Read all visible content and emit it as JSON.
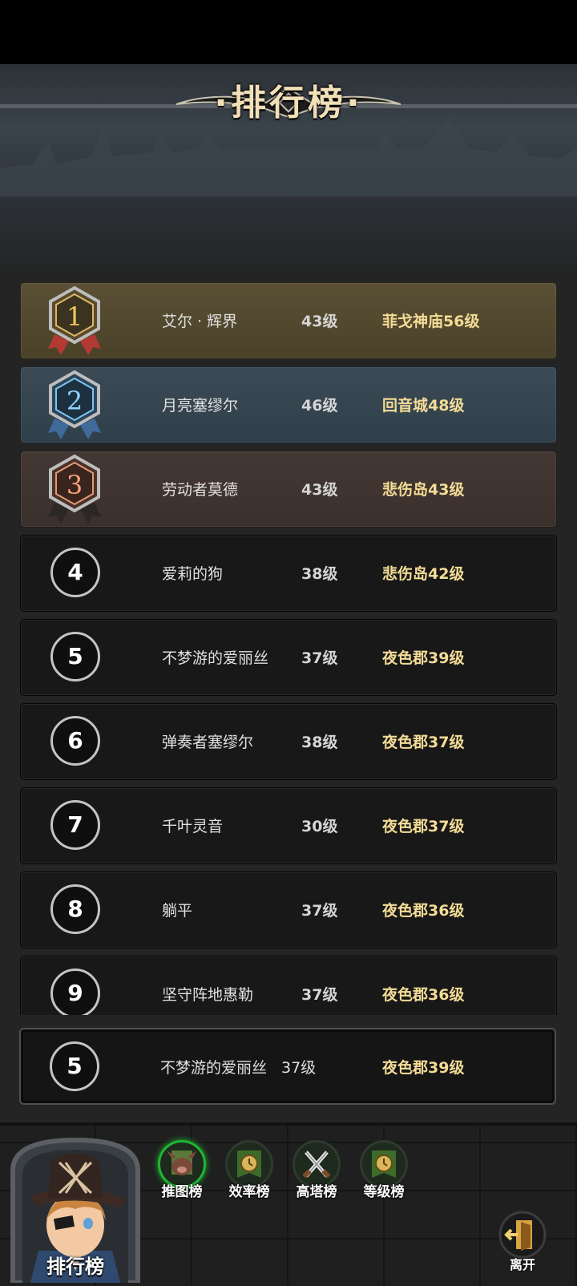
{
  "header": {
    "title": "·排行榜·"
  },
  "leaderboard": [
    {
      "rank": "1",
      "medal": "gold",
      "name": "艾尔 · 辉界",
      "level": "43级",
      "stage": "菲戈神庙56级"
    },
    {
      "rank": "2",
      "medal": "silver",
      "name": "月亮塞缪尔",
      "level": "46级",
      "stage": "回音城48级"
    },
    {
      "rank": "3",
      "medal": "bronze",
      "name": "劳动者莫德",
      "level": "43级",
      "stage": "悲伤岛43级"
    },
    {
      "rank": "4",
      "name": "爱莉的狗",
      "level": "38级",
      "stage": "悲伤岛42级"
    },
    {
      "rank": "5",
      "name": "不梦游的爱丽丝",
      "level": "37级",
      "stage": "夜色郡39级"
    },
    {
      "rank": "6",
      "name": "弹奏者塞缪尔",
      "level": "38级",
      "stage": "夜色郡37级"
    },
    {
      "rank": "7",
      "name": "千叶灵音",
      "level": "30级",
      "stage": "夜色郡37级"
    },
    {
      "rank": "8",
      "name": "躺平",
      "level": "37级",
      "stage": "夜色郡36级"
    },
    {
      "rank": "9",
      "name": "坚守阵地惠勒",
      "level": "37级",
      "stage": "夜色郡36级"
    }
  ],
  "my_rank": {
    "rank": "5",
    "name": "不梦游的爱丽丝",
    "level": "37级",
    "stage": "夜色郡39级"
  },
  "footer": {
    "portrait_label": "排行榜",
    "tabs": [
      {
        "label": "推图榜",
        "icon": "boar-icon",
        "active": true
      },
      {
        "label": "效率榜",
        "icon": "clock-banner-icon",
        "active": false
      },
      {
        "label": "高塔榜",
        "icon": "crossed-swords-icon",
        "active": false
      },
      {
        "label": "等级榜",
        "icon": "clock-banner-icon",
        "active": false
      }
    ],
    "leave_label": "离开"
  },
  "colors": {
    "gold_row": "#4f452d",
    "silver_row": "#344450",
    "bronze_row": "#3e3330",
    "stage_text": "#f3dc96",
    "active_tab": "#1fb533"
  }
}
